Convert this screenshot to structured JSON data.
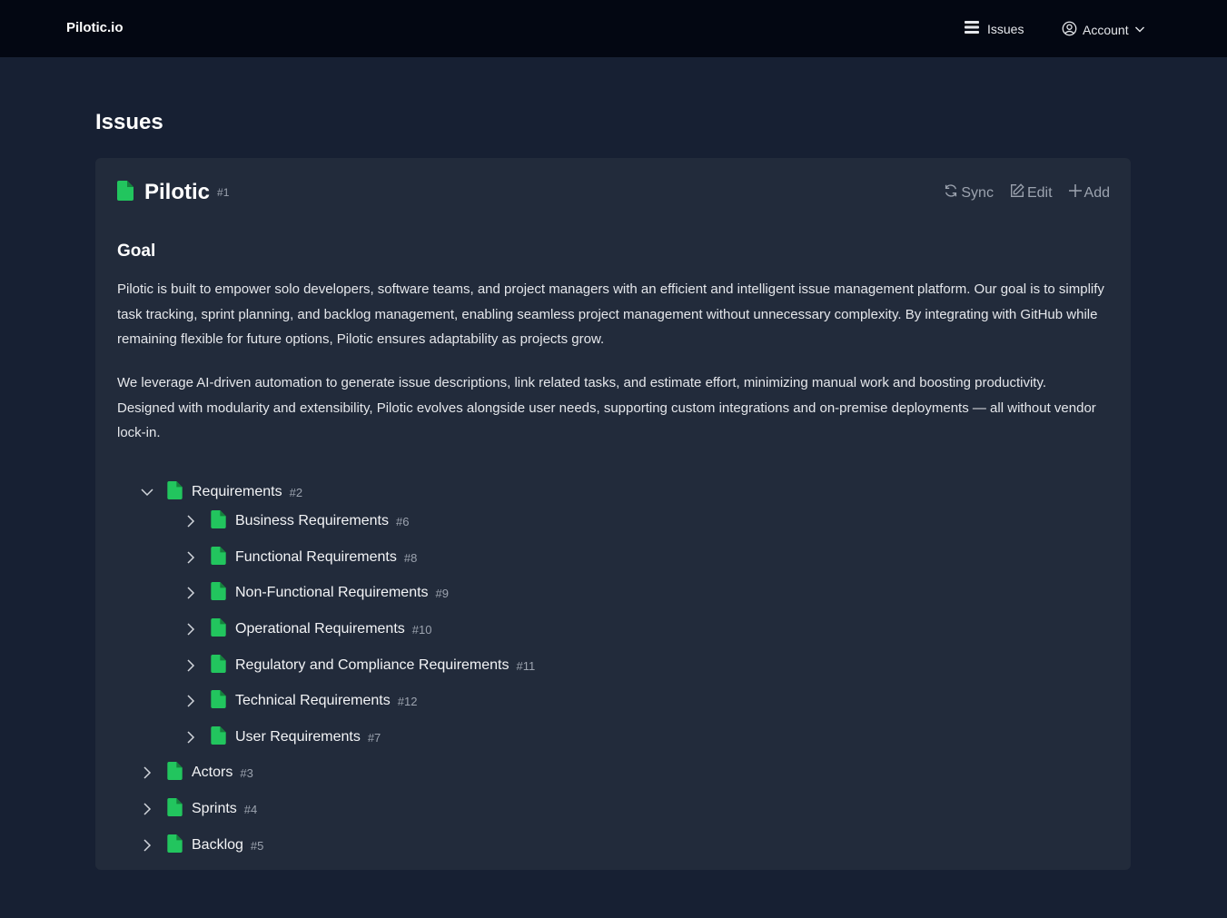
{
  "nav": {
    "brand": "Pilotic.io",
    "issues_label": "Issues",
    "account_label": "Account"
  },
  "page": {
    "title": "Issues"
  },
  "card": {
    "title": "Pilotic",
    "number": "#1",
    "actions": {
      "sync": "Sync",
      "edit": "Edit",
      "add": "Add"
    },
    "goal_heading": "Goal",
    "paragraphs": [
      "Pilotic is built to empower solo developers, software teams, and project managers with an efficient and intelligent issue management platform. Our goal is to simplify task tracking, sprint planning, and backlog management, enabling seamless project management without unnecessary complexity. By integrating with GitHub while remaining flexible for future options, Pilotic ensures adaptability as projects grow.",
      "We leverage AI-driven automation to generate issue descriptions, link related tasks, and estimate effort, minimizing manual work and boosting productivity. Designed with modularity and extensibility, Pilotic evolves alongside user needs, supporting custom integrations and on-premise deployments — all without vendor lock-in."
    ]
  },
  "tree": [
    {
      "label": "Requirements",
      "number": "#2",
      "expanded": true,
      "children": [
        {
          "label": "Business Requirements",
          "number": "#6"
        },
        {
          "label": "Functional Requirements",
          "number": "#8"
        },
        {
          "label": "Non-Functional Requirements",
          "number": "#9"
        },
        {
          "label": "Operational Requirements",
          "number": "#10"
        },
        {
          "label": "Regulatory and Compliance Requirements",
          "number": "#11"
        },
        {
          "label": "Technical Requirements",
          "number": "#12"
        },
        {
          "label": "User Requirements",
          "number": "#7"
        }
      ]
    },
    {
      "label": "Actors",
      "number": "#3",
      "expanded": false
    },
    {
      "label": "Sprints",
      "number": "#4",
      "expanded": false
    },
    {
      "label": "Backlog",
      "number": "#5",
      "expanded": false
    }
  ],
  "colors": {
    "accent_green": "#22c55e",
    "muted": "#9ca3af",
    "card_bg": "#222b3b",
    "topbar_bg": "#030712"
  },
  "icons": {
    "doc": "file-icon",
    "sync": "refresh-icon",
    "edit": "pencil-square-icon",
    "add": "plus-icon",
    "issues": "list-icon",
    "account": "user-circle-icon"
  }
}
